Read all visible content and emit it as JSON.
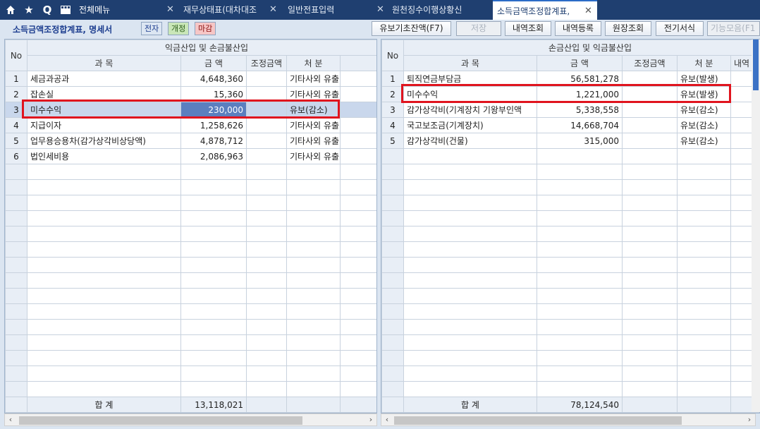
{
  "tabs": {
    "menu_label": "전체메뉴",
    "items": [
      {
        "label": "재무상태표(대차대조"
      },
      {
        "label": "일반전표입력"
      },
      {
        "label": "원천징수이행상황신"
      },
      {
        "label": "소득금액조정합계표,"
      }
    ]
  },
  "toolbar": {
    "title": "소득금액조정합계표, 명세서",
    "tag_elec": "전자",
    "tag_revise": "개정",
    "tag_close": "마감",
    "buttons": [
      "유보기초잔액(F7)",
      "저장",
      "내역조회",
      "내역등록",
      "원장조회",
      "전기서식",
      "기능모음(F1"
    ]
  },
  "left": {
    "group_header": "익금산입 및 손금불산입",
    "col_no": "No",
    "col_item": "과 목",
    "col_amount": "금 액",
    "col_adjust": "조정금액",
    "col_disp": "처 분",
    "rows": [
      {
        "no": "1",
        "item": "세금과공과",
        "amount": "4,648,360",
        "disp": "기타사외 유출"
      },
      {
        "no": "2",
        "item": "잡손실",
        "amount": "15,360",
        "disp": "기타사외 유출"
      },
      {
        "no": "3",
        "item": "미수수익",
        "amount": "230,000",
        "disp": "유보(감소)"
      },
      {
        "no": "4",
        "item": "지급이자",
        "amount": "1,258,626",
        "disp": "기타사외 유출"
      },
      {
        "no": "5",
        "item": "업무용승용차(감가상각비상당액)",
        "amount": "4,878,712",
        "disp": "기타사외 유출"
      },
      {
        "no": "6",
        "item": "법인세비용",
        "amount": "2,086,963",
        "disp": "기타사외 유출"
      }
    ],
    "total_label": "합 계",
    "total_amount": "13,118,021"
  },
  "right": {
    "group_header": "손금산입 및 익금불산입",
    "col_no": "No",
    "col_item": "과 목",
    "col_amount": "금 액",
    "col_adjust": "조정금액",
    "col_disp": "처 분",
    "col_extra": "내역",
    "rows": [
      {
        "no": "1",
        "item": "퇴직연금부담금",
        "amount": "56,581,278",
        "disp": "유보(발생)"
      },
      {
        "no": "2",
        "item": "미수수익",
        "amount": "1,221,000",
        "disp": "유보(발생)"
      },
      {
        "no": "3",
        "item": "감가상각비(기계장치 기왕부인액",
        "amount": "5,338,558",
        "disp": "유보(감소)"
      },
      {
        "no": "4",
        "item": "국고보조금(기계장치)",
        "amount": "14,668,704",
        "disp": "유보(감소)"
      },
      {
        "no": "5",
        "item": "감가상각비(건물)",
        "amount": "315,000",
        "disp": "유보(감소)"
      }
    ],
    "total_label": "합 계",
    "total_amount": "78,124,540"
  },
  "colors": {
    "tabbar": "#1f3f70",
    "highlight_border": "#e0141e",
    "selected_cell": "#5b7fbf"
  }
}
